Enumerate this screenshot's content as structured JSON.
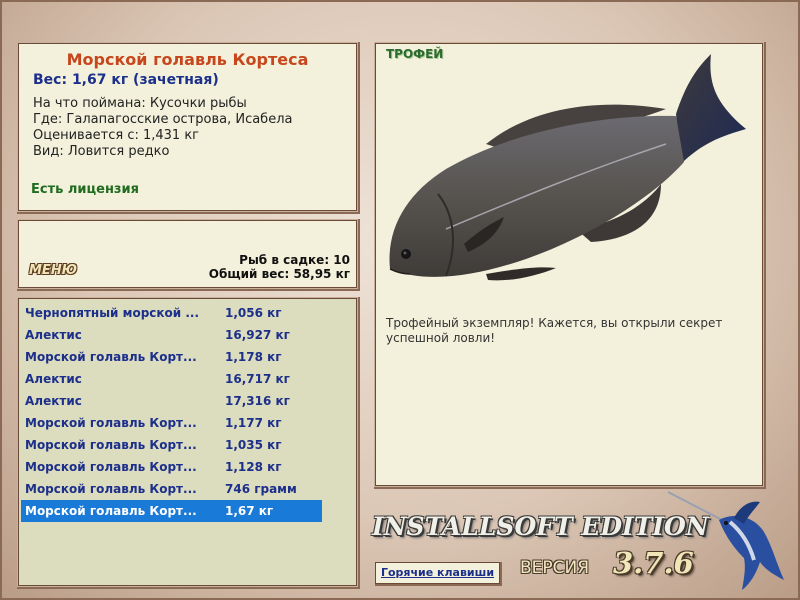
{
  "info": {
    "title": "Морской голавль Кортеса",
    "weight": "Вес: 1,67 кг (зачетная)",
    "bait": "На что поймана: Кусочки рыбы",
    "place": "Где: Галапагосские острова, Исабела",
    "value": "Оценивается с: 1,431 кг",
    "kind": "Вид: Ловится редко",
    "license": "Есть лицензия"
  },
  "menu": {
    "label": "МЕНЮ",
    "fish_in_cage": "Рыб в садке: 10",
    "total_weight": "Общий вес: 58,95 кг"
  },
  "catch_list": [
    {
      "name": "Чернопятный морской ...",
      "weight": "1,056 кг"
    },
    {
      "name": "Алектис",
      "weight": "16,927 кг"
    },
    {
      "name": "Морской голавль Корт...",
      "weight": "1,178 кг"
    },
    {
      "name": "Алектис",
      "weight": "16,717 кг"
    },
    {
      "name": "Алектис",
      "weight": "17,316 кг"
    },
    {
      "name": "Морской голавль Корт...",
      "weight": "1,177 кг"
    },
    {
      "name": "Морской голавль Корт...",
      "weight": "1,035 кг"
    },
    {
      "name": "Морской голавль Корт...",
      "weight": "1,128 кг"
    },
    {
      "name": "Морской голавль Корт...",
      "weight": "746 грамм"
    },
    {
      "name": "Морской голавль Корт...",
      "weight": "1,67 кг",
      "selected": true
    }
  ],
  "trophy": {
    "label": "ТРОФЕЙ",
    "description": "Трофейный экземпляр! Кажется, вы открыли секрет успешной ловли!"
  },
  "branding": {
    "edition": "INSTALLSOFT EDITION",
    "version_label": "ВЕРСИЯ",
    "version_number": "3.7.6"
  },
  "hotkeys_label": "Горячие клавиши",
  "colors": {
    "panel": "#f3f1dc",
    "list_bg": "#dcdcbf",
    "title": "#c8461b",
    "weight_text": "#1c2f8a",
    "license": "#1f6b1f",
    "selection": "#1a7ad8"
  }
}
